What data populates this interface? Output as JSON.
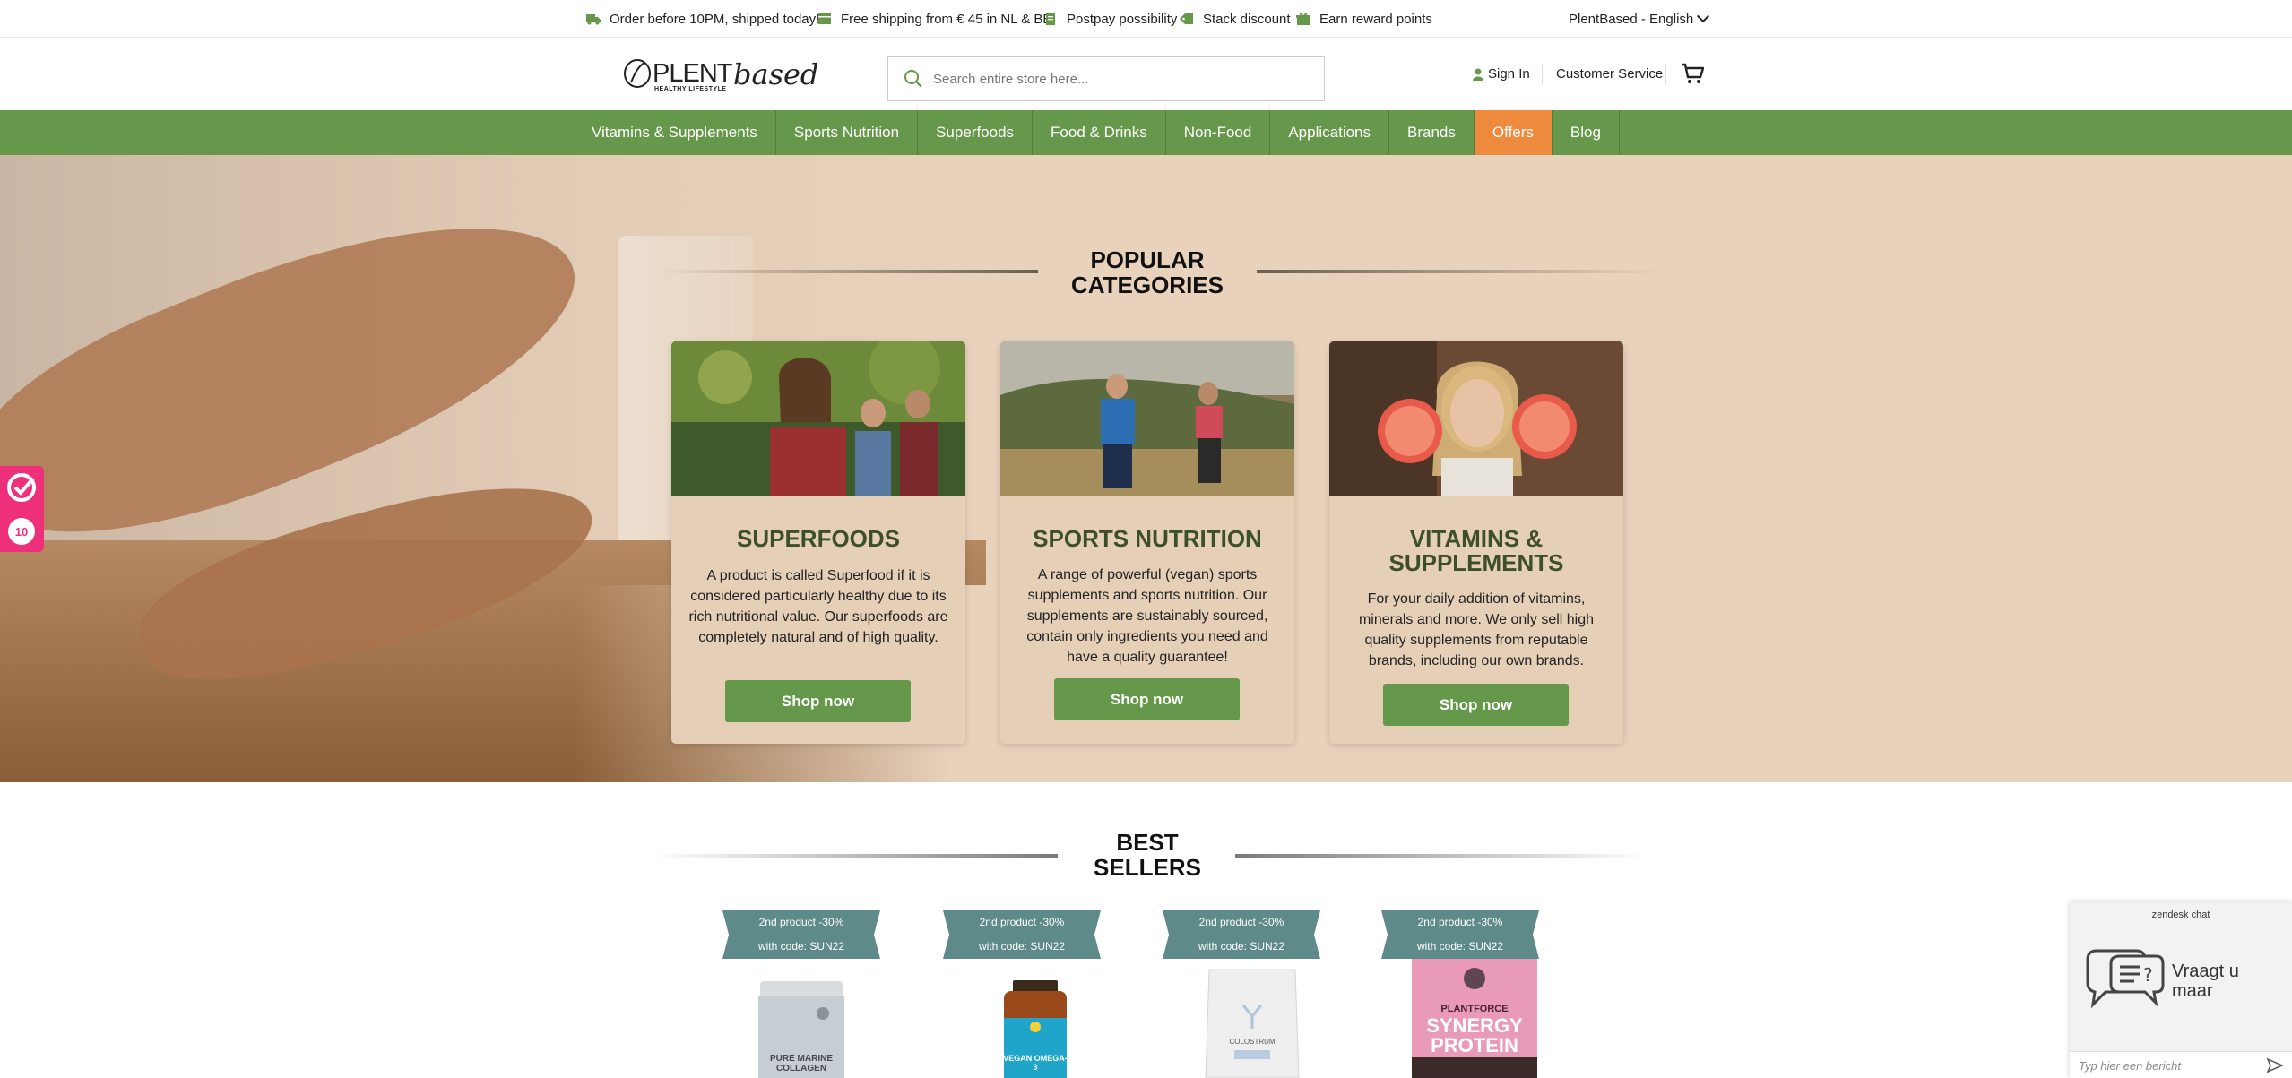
{
  "topbar": {
    "usps": [
      {
        "icon": "truck-icon",
        "label": "Order before 10PM, shipped today!"
      },
      {
        "icon": "box-icon",
        "label": "Free shipping from € 45 in NL & BE"
      },
      {
        "icon": "receipt-icon",
        "label": "Postpay possibility"
      },
      {
        "icon": "tag-icon",
        "label": "Stack discount"
      },
      {
        "icon": "gift-icon",
        "label": "Earn reward points"
      }
    ],
    "language": "PlentBased - English"
  },
  "header": {
    "logo_text": "PLENT based",
    "logo_sub": "HEALTHY LIFESTYLE",
    "search_placeholder": "Search entire store here...",
    "sign_in": "Sign In",
    "customer_service": "Customer Service"
  },
  "nav": {
    "items": [
      "Vitamins & Supplements",
      "Sports Nutrition",
      "Superfoods",
      "Food & Drinks",
      "Non-Food",
      "Applications",
      "Brands",
      "Offers",
      "Blog"
    ]
  },
  "popular": {
    "title_line1": "POPULAR",
    "title_line2": "CATEGORIES",
    "cards": [
      {
        "title": "SUPERFOODS",
        "text": "A product is called Superfood if it is considered particularly healthy due to its rich nutritional value. Our superfoods are completely natural and of high quality.",
        "button": "Shop now"
      },
      {
        "title": "SPORTS NUTRITION",
        "text": "A range of powerful (vegan) sports supplements and sports nutrition. Our supplements are sustainably sourced, contain only ingredients you need and have a quality guarantee!",
        "button": "Shop now"
      },
      {
        "title_line1": "VITAMINS &",
        "title_line2": "SUPPLEMENTS",
        "text": "For your daily addition of vitamins, minerals and more. We only sell high quality supplements from reputable brands, including our own brands.",
        "button": "Shop now"
      }
    ]
  },
  "bestsellers": {
    "title_line1": "BEST",
    "title_line2": "SELLERS",
    "products": [
      {
        "ribbon1": "2nd product -30%",
        "ribbon2": "with code: SUN22",
        "label": "PURE MARINE COLLAGEN"
      },
      {
        "ribbon1": "2nd product -30%",
        "ribbon2": "with code: SUN22",
        "label": "VEGAN OMEGA-3"
      },
      {
        "ribbon1": "2nd product -30%",
        "ribbon2": "with code: SUN22",
        "label": "COLOSTRUM"
      },
      {
        "ribbon1": "2nd product -30%",
        "ribbon2": "with code: SUN22",
        "label_top": "PLANTFORCE",
        "label": "SYNERGY PROTEIN"
      }
    ]
  },
  "badge": {
    "score": "10"
  },
  "zendesk": {
    "title": "zendesk chat",
    "message_line1": "Vraagt u",
    "message_line2": "maar",
    "input_placeholder": "Typ hier een bericht"
  },
  "colors": {
    "brand_green": "#65984a",
    "offers_orange": "#ee8a3d",
    "hero_bg": "#e8d2bc",
    "heading_green": "#3d4f2a",
    "badge_pink": "#ee2f7a",
    "ribbon_teal": "#5e8a8a"
  }
}
